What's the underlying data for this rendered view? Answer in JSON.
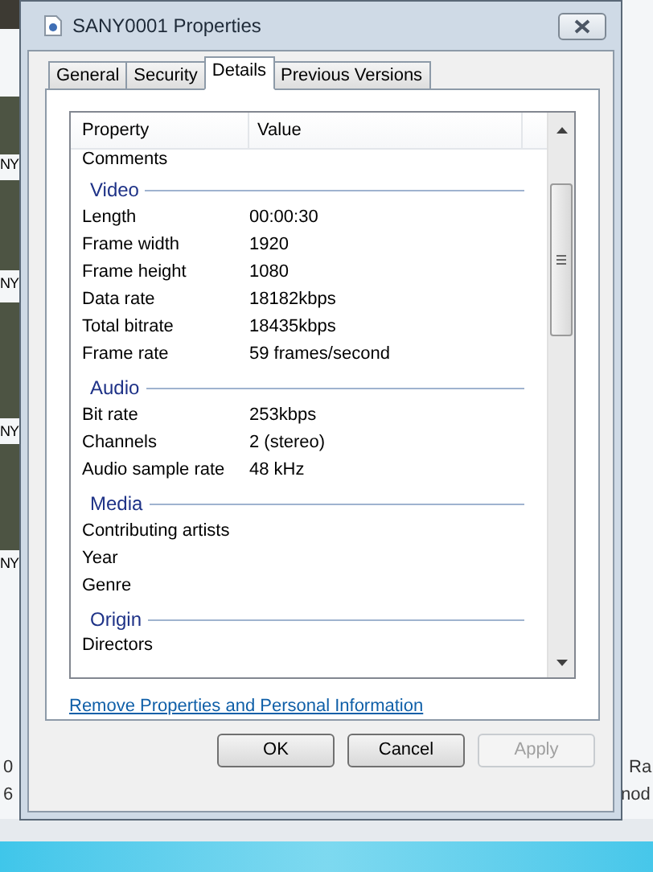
{
  "background": {
    "thumbnail_labels": [
      "NY",
      "NY",
      "NY",
      "NY"
    ],
    "left_texts": [
      "0",
      "6"
    ],
    "right_texts": [
      "Ra",
      "nod"
    ]
  },
  "window": {
    "title": "SANY0001 Properties"
  },
  "tabs": [
    {
      "label": "General",
      "selected": false
    },
    {
      "label": "Security",
      "selected": false
    },
    {
      "label": "Details",
      "selected": true
    },
    {
      "label": "Previous Versions",
      "selected": false
    }
  ],
  "list": {
    "columns": [
      "Property",
      "Value"
    ],
    "rows": [
      {
        "kind": "cut-top",
        "property": "Comments"
      },
      {
        "kind": "group",
        "label": "Video"
      },
      {
        "kind": "prop",
        "property": "Length",
        "value": "00:00:30"
      },
      {
        "kind": "prop",
        "property": "Frame width",
        "value": "1920"
      },
      {
        "kind": "prop",
        "property": "Frame height",
        "value": "1080"
      },
      {
        "kind": "prop",
        "property": "Data rate",
        "value": "18182kbps"
      },
      {
        "kind": "prop",
        "property": "Total bitrate",
        "value": "18435kbps"
      },
      {
        "kind": "prop",
        "property": "Frame rate",
        "value": "59 frames/second"
      },
      {
        "kind": "group",
        "label": "Audio"
      },
      {
        "kind": "prop",
        "property": "Bit rate",
        "value": "253kbps"
      },
      {
        "kind": "prop",
        "property": "Channels",
        "value": "2 (stereo)"
      },
      {
        "kind": "prop",
        "property": "Audio sample rate",
        "value": "48 kHz"
      },
      {
        "kind": "group",
        "label": "Media"
      },
      {
        "kind": "prop",
        "property": "Contributing artists"
      },
      {
        "kind": "prop",
        "property": "Year"
      },
      {
        "kind": "prop",
        "property": "Genre"
      },
      {
        "kind": "group",
        "label": "Origin"
      },
      {
        "kind": "cut-bottom",
        "property": "Directors"
      }
    ]
  },
  "link": "Remove Properties and Personal Information",
  "buttons": [
    {
      "label": "OK",
      "disabled": false
    },
    {
      "label": "Cancel",
      "disabled": false
    },
    {
      "label": "Apply",
      "disabled": true
    }
  ]
}
